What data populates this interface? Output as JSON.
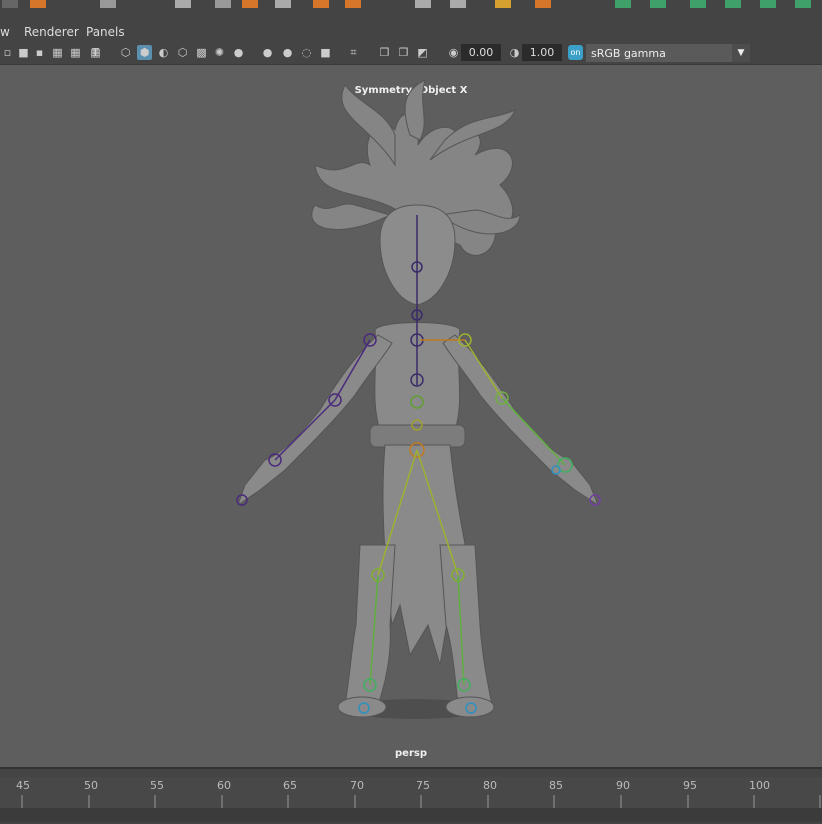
{
  "menu": {
    "view": "w",
    "renderer": "Renderer",
    "panels": "Panels"
  },
  "toolbar": {
    "exposure": "0.00",
    "gamma": "1.00",
    "color_space": "sRGB gamma"
  },
  "viewport": {
    "symmetry_label": "Symmetry: Object X",
    "camera_label": "persp"
  },
  "timeline": {
    "ticks": [
      "45",
      "50",
      "55",
      "60",
      "65",
      "70",
      "75",
      "80",
      "85",
      "90",
      "95",
      "100"
    ]
  },
  "colors": {
    "accent": "#5a8fb0",
    "viewport_bg": "#5e5e5e",
    "panel_bg": "#444444"
  }
}
